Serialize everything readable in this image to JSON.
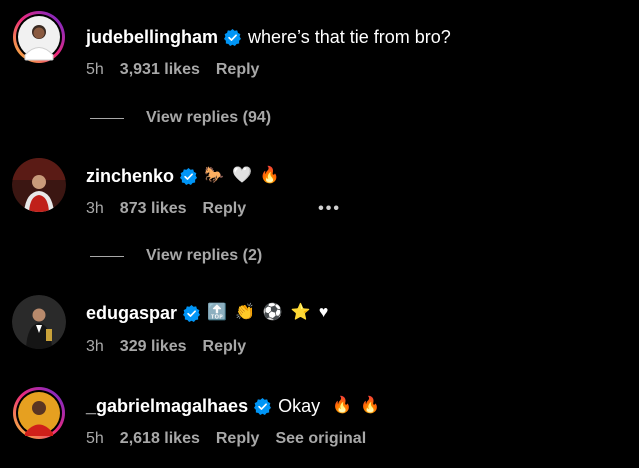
{
  "comments": [
    {
      "username": "judebellingham",
      "verified": true,
      "text": "where’s that tie from bro?",
      "time": "5h",
      "likes": "3,931 likes",
      "reply_label": "Reply",
      "view_replies": "View replies (94)"
    },
    {
      "username": "zinchenko",
      "verified": true,
      "emojis": [
        "🐎",
        "🤍",
        "🔥"
      ],
      "time": "3h",
      "likes": "873 likes",
      "reply_label": "Reply",
      "more_label": "•••",
      "view_replies": "View replies (2)"
    },
    {
      "username": "edugaspar",
      "verified": true,
      "emojis": [
        "🔝",
        "👏",
        "⚽",
        "⭐",
        "♥"
      ],
      "time": "3h",
      "likes": "329 likes",
      "reply_label": "Reply"
    },
    {
      "username": "_gabrielmagalhaes",
      "verified": true,
      "text": "Okay",
      "emojis": [
        "🔥",
        "🔥"
      ],
      "time": "5h",
      "likes": "2,618 likes",
      "reply_label": "Reply",
      "see_original": "See original"
    }
  ],
  "colors": {
    "background": "#000000",
    "primary_text": "#ffffff",
    "secondary_text": "#a8a8a8",
    "verified_badge": "#0095f6",
    "story_ring_start": "#f9ce34",
    "story_ring_mid": "#ee2a7b",
    "story_ring_end": "#6228d7"
  }
}
